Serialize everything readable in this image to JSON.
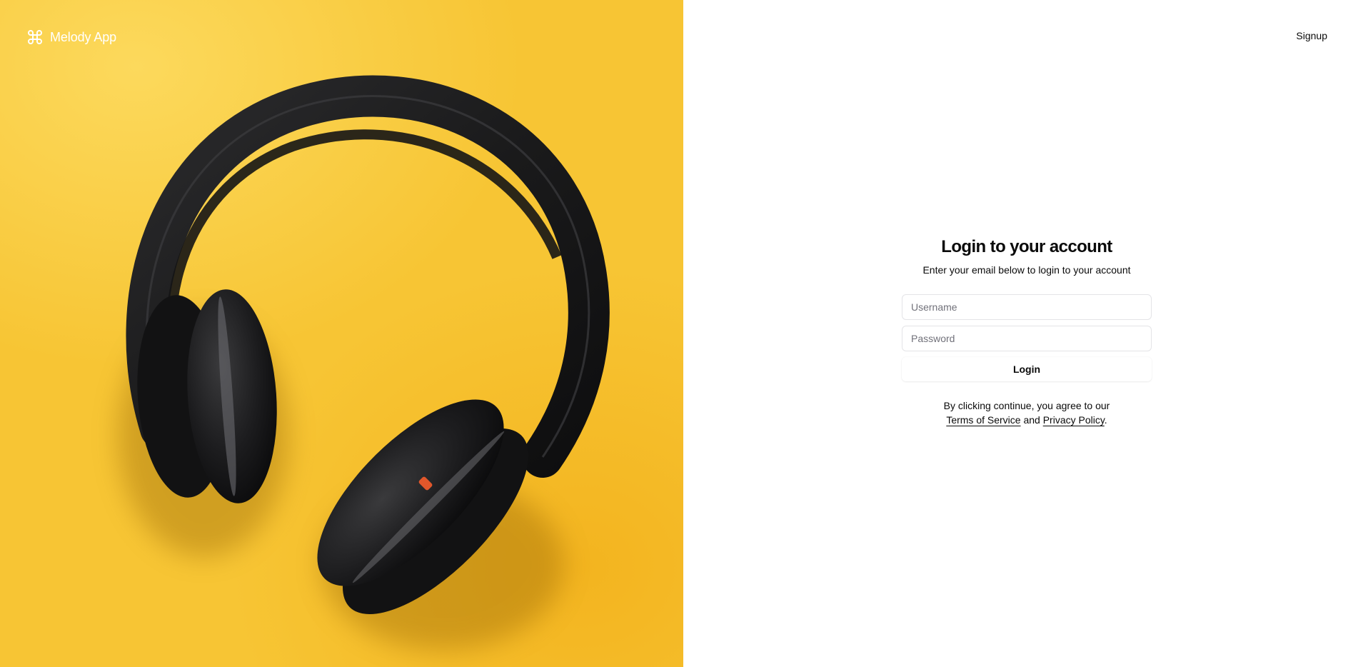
{
  "brand": {
    "name": "Melody App",
    "icon": "command-icon"
  },
  "hero": {
    "image": "headphones-photo",
    "background_color": "#f7c534"
  },
  "header": {
    "signup_label": "Signup"
  },
  "login": {
    "title": "Login to your account",
    "subtitle": "Enter your email below to login to your account",
    "username_placeholder": "Username",
    "password_placeholder": "Password",
    "username_value": "",
    "password_value": "",
    "submit_label": "Login"
  },
  "legal": {
    "prefix": "By clicking continue, you agree to our",
    "terms_label": "Terms of Service",
    "conjunction": "and",
    "privacy_label": "Privacy Policy",
    "suffix": "."
  }
}
